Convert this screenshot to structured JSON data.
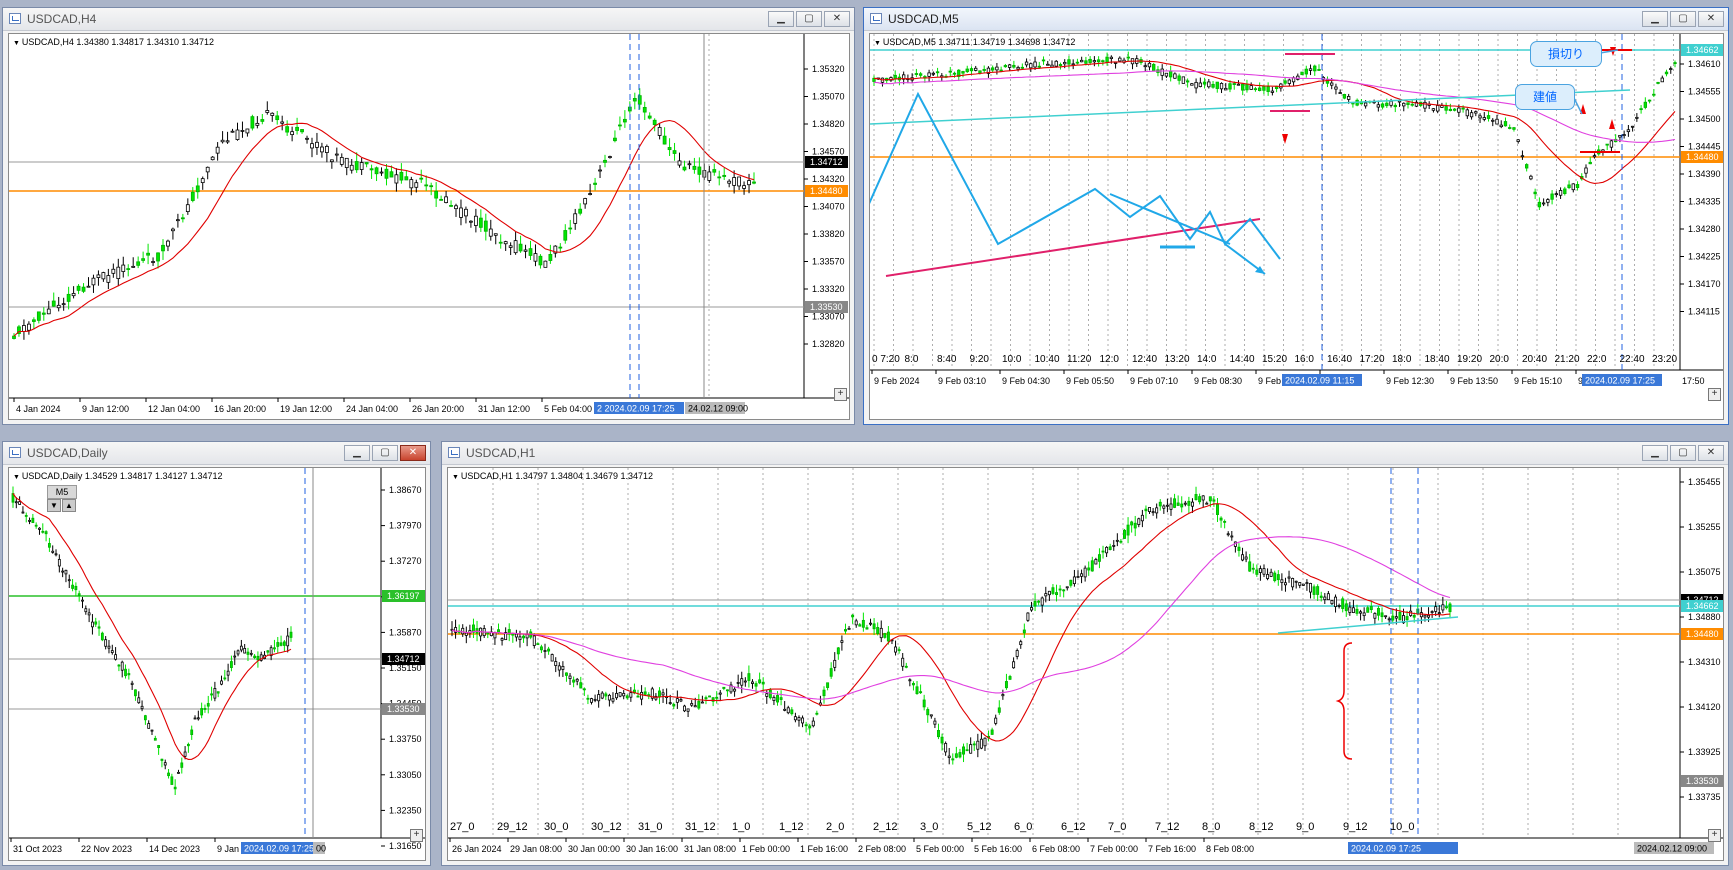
{
  "windows": {
    "h4": {
      "title": "USDCAD,H4",
      "info": "USDCAD,H4  1.34380 1.34817 1.34310 1.34712",
      "price_labels": [
        "1.35320",
        "1.35070",
        "1.34820",
        "1.34570",
        "1.34320",
        "1.34070",
        "1.33820",
        "1.33570",
        "1.33320",
        "1.33070",
        "1.32820"
      ],
      "current_price": "1.34712",
      "orange_price": "1.34480",
      "gray_price": "1.33530",
      "time_labels": [
        "4 Jan 2024",
        "9 Jan 12:00",
        "12 Jan 04:00",
        "16 Jan 20:00",
        "19 Jan 12:00",
        "24 Jan 04:00",
        "26 Jan 20:00",
        "31 Jan 12:00",
        "5 Feb 04:00"
      ],
      "time_highlight": "2 2024.02.09 17:25",
      "time_end": "24.02.12 09:00"
    },
    "m5": {
      "title": "USDCAD,M5",
      "info": "USDCAD,M5  1.34711 1.34719 1.34698 1.34712",
      "price_labels": [
        "1.34610",
        "1.34555",
        "1.34500",
        "1.34445",
        "1.34390",
        "1.34335",
        "1.34280",
        "1.34225",
        "1.34170",
        "1.34115"
      ],
      "cyan_price": "1.34662",
      "orange_price": "1.34480",
      "hours_row": [
        "0 7:20",
        "8:0",
        "8:40",
        "9:20",
        "10:0",
        "10:40",
        "11:20",
        "12:0",
        "12:40",
        "13:20",
        "14:0",
        "14:40",
        "15:20",
        "16:0",
        "16:40",
        "17:20",
        "18:0",
        "18:40",
        "19:20",
        "20:0",
        "20:40",
        "21:20",
        "22:0",
        "22:40",
        "23:20"
      ],
      "time_labels": [
        "9 Feb 2024",
        "9 Feb 03:10",
        "9 Feb 04:30",
        "9 Feb 05:50",
        "9 Feb 07:10",
        "9 Feb 08:30",
        "9 Feb",
        "0",
        "9 Feb 12:30",
        "9 Feb 13:50",
        "9 Feb 15:10",
        "9"
      ],
      "time_highlight_1": "2024.02.09 11:15",
      "time_highlight_2": "2024.02.09 17:25",
      "time_end": "17:50",
      "callout_stop": "損切り",
      "callout_entry": "建値"
    },
    "daily": {
      "title": "USDCAD,Daily",
      "info": "USDCAD,Daily  1.34529 1.34817 1.34127 1.34712",
      "m5_button": "M5",
      "price_labels": [
        "1.38670",
        "1.37970",
        "1.37270",
        "1.36570",
        "1.35870",
        "1.35150",
        "1.34450",
        "1.33750",
        "1.33050",
        "1.32350",
        "1.31650"
      ],
      "green_price": "1.36197",
      "current_price": "1.34712",
      "gray_price": "1.33530",
      "time_labels": [
        "31 Oct 2023",
        "22 Nov 2023",
        "14 Dec 2023",
        "9 Jan 2024"
      ],
      "time_highlight": "2024.02.09 17:25",
      "time_end": "00"
    },
    "h1": {
      "title": "USDCAD,H1",
      "info": "USDCAD,H1  1.34797 1.34804 1.34679 1.34712",
      "price_labels": [
        "1.35455",
        "1.35255",
        "1.35075",
        "1.34880",
        "1.34310",
        "1.34120",
        "1.33925",
        "1.33735"
      ],
      "current_price": "1.34712",
      "cyan_price": "1.34662",
      "orange_price": "1.34480",
      "gray_price": "1.33530",
      "day_row": [
        "27_0",
        "29_12",
        "30_0",
        "30_12",
        "31_0",
        "31_12",
        "1_0",
        "1_12",
        "2_0",
        "2_12",
        "3_0",
        "5_12",
        "6_0",
        "6_12",
        "7_0",
        "7_12",
        "8_0",
        "8_12",
        "9_0",
        "9_12",
        "10_0"
      ],
      "time_labels": [
        "26 Jan 2024",
        "29 Jan 08:00",
        "30 Jan 00:00",
        "30 Jan 16:00",
        "31 Jan 08:00",
        "1 Feb 00:00",
        "1 Feb 16:00",
        "2 Feb 08:00",
        "5 Feb 00:00",
        "5 Feb 16:00",
        "6 Feb 08:00",
        "7 Feb 00:00",
        "7 Feb 16:00",
        "8 Feb 08:00"
      ],
      "time_highlight": "2024.02.09 17:25",
      "time_end": "2024.02.12 09:00"
    }
  },
  "colors": {
    "bull": "#00e600",
    "bear": "#000000",
    "ma_red": "#e00000",
    "ma_magenta": "#e040e0",
    "orange": "#ff8c00",
    "cyan": "#40d0d0",
    "blue_dash": "#2060e0",
    "pattern_blue": "#20a8e8",
    "trend_pink": "#e0206a"
  }
}
